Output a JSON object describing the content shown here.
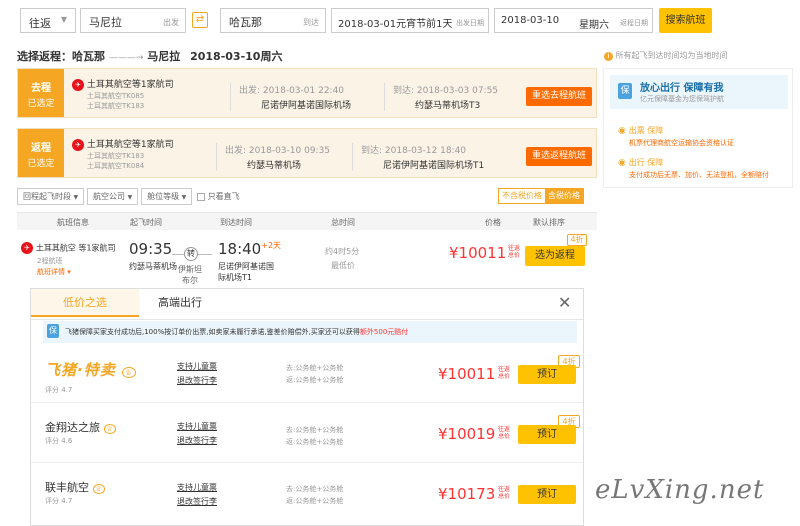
{
  "search": {
    "trip_type": "往返",
    "from_city": "马尼拉",
    "from_suffix": "出发",
    "swap_icon": "swap-icon",
    "to_city": "哈瓦那",
    "to_suffix": "到达",
    "depart_date": "2018-03-01元宵节前1天",
    "depart_suffix": "出发日期",
    "return_date": "2018-03-10",
    "return_weekday": "星期六",
    "return_suffix": "返程日期",
    "search_button": "搜索航班"
  },
  "header": {
    "title": "选择返程：哈瓦那",
    "arrow": "———→",
    "dest": "马尼拉",
    "date": "2018-03-10周六",
    "note": "所有起飞到达时间均为当地时间"
  },
  "outbound": {
    "tab_top": "去程",
    "tab_bottom": "已选定",
    "airline": "土耳其航空等1家航司",
    "flight1": "土耳其航空TK085",
    "flight2": "土耳其航空TK183",
    "depart_label": "出发:",
    "depart_time": "2018-03-01 22:40",
    "depart_airport": "尼诺伊阿基诺国际机场",
    "arrive_label": "到达:",
    "arrive_time": "2018-03-03 07:55",
    "arrive_airport": "约瑟马蒂机场T3",
    "reselect": "重选去程航班"
  },
  "inbound": {
    "tab_top": "返程",
    "tab_bottom": "已选定",
    "airline": "土耳其航空等1家航司",
    "flight1": "土耳其航空TK183",
    "flight2": "土耳其航空TK084",
    "depart_label": "出发:",
    "depart_time": "2018-03-10 09:35",
    "depart_airport": "约瑟马蒂机场",
    "arrive_label": "到达:",
    "arrive_time": "2018-03-12 18:40",
    "arrive_airport": "尼诺伊阿基诺国际机场T1",
    "reselect": "重选返程航班"
  },
  "filters": {
    "time": "回程起飞时段",
    "airline": "航空公司",
    "cabin": "舱位等级",
    "direct": "只看直飞",
    "price_excl": "不含税价格",
    "price_incl": "含税价格"
  },
  "columns": {
    "info": "航班信息",
    "depart": "起飞时间",
    "arrive": "到达时间",
    "duration": "总时间",
    "price": "价格",
    "sort": "默认排序"
  },
  "result": {
    "airline": "土耳其航空 等1家航司",
    "stops": "2程航班",
    "details": "航班详情",
    "depart_time": "09:35",
    "depart_airport": "约瑟马蒂机场",
    "transfer": "转",
    "transfer_city": "伊斯坦布尔",
    "arrive_time": "18:40",
    "arrive_plus": "+2天",
    "arrive_airport": "尼诺伊阿基诺国际机场T1",
    "duration": "约4时5分",
    "duration_note": "最低价",
    "price": "¥10011",
    "price_tag": "往返总价",
    "discount": "4折",
    "select_button": "选为返程"
  },
  "panel": {
    "tab_low": "低价之选",
    "tab_high": "高端出行",
    "guarantee_text": "飞猪保障买家支付成功后,100%按订单价出票,如卖家未履行承诺,鉴差价赔偿外,买家还可以获得",
    "guarantee_highlight": "额外500元赔付",
    "close_icon": "close-icon",
    "vendors": [
      {
        "name": "飞猪·特卖",
        "rating": "评分 4.7",
        "child": "支持儿童票",
        "rules": "退改签行李",
        "cabin_out": "去:公务舱+公务舱",
        "cabin_ret": "返:公务舱+公务舱",
        "price": "¥10011",
        "price_tag": "往返总价",
        "discount": "4折",
        "button": "预订"
      },
      {
        "name": "金翔达之旅",
        "rating": "评分 4.6",
        "child": "支持儿童票",
        "rules": "退改签行李",
        "cabin_out": "去:公务舱+公务舱",
        "cabin_ret": "返:公务舱+公务舱",
        "price": "¥10019",
        "price_tag": "往返总价",
        "discount": "4折",
        "button": "预订"
      },
      {
        "name": "联丰航空",
        "rating": "评分 4.7",
        "child": "支持儿童票",
        "rules": "退改签行李",
        "cabin_out": "去:公务舱+公务舱",
        "cabin_ret": "返:公务舱+公务舱",
        "price": "¥10173",
        "price_tag": "往返总价",
        "discount": "",
        "button": "预订"
      }
    ]
  },
  "promo": {
    "title": "放心出行 保障有我",
    "subtitle": "亿元保障基金为您保驾护航",
    "item1_title": "出票 保障",
    "item1_text": "机票代理商航空运输协会资格认证",
    "item2_title": "出行 保障",
    "item2_text": "支付成功后无票、加价、无法登机，全额赔付"
  },
  "watermark": "eLvXing.net",
  "colors": {
    "accent_orange": "#ff6a00",
    "accent_yellow": "#ffc200",
    "tab_orange": "#f5a623",
    "price_red": "#f33"
  }
}
